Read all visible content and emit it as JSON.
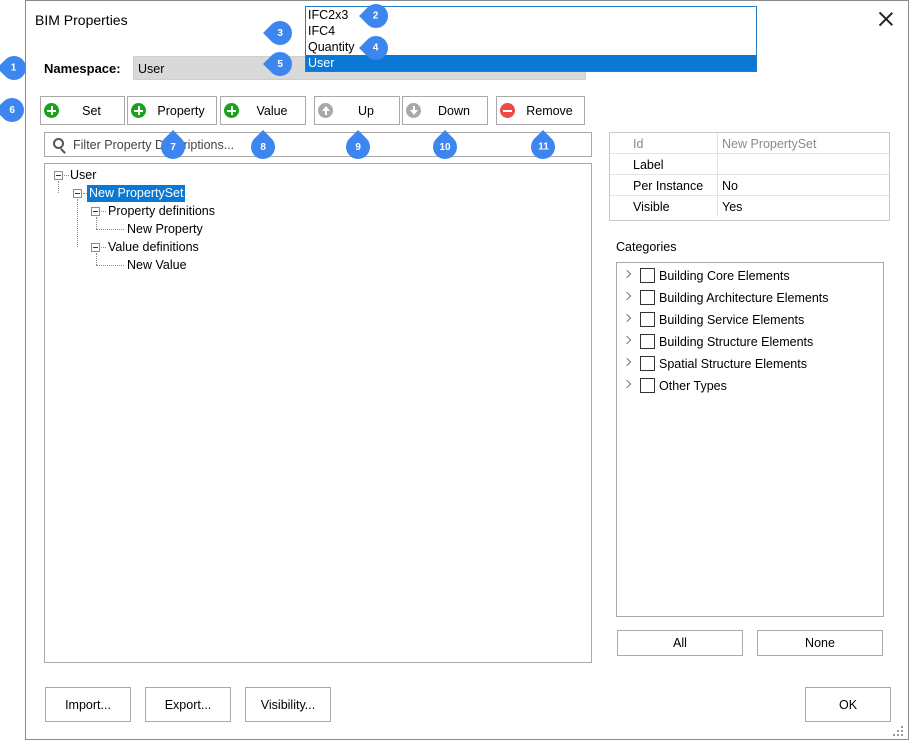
{
  "dialog": {
    "title": "BIM Properties"
  },
  "namespace": {
    "label": "Namespace:",
    "value": "User",
    "options": [
      "IFC2x3",
      "IFC4",
      "Quantity",
      "User"
    ],
    "selected_option": "User"
  },
  "toolbar": {
    "set": "Set",
    "property": "Property",
    "value": "Value",
    "up": "Up",
    "down": "Down",
    "remove": "Remove"
  },
  "filter": {
    "placeholder": "Filter Property Descriptions..."
  },
  "tree": {
    "root": "User",
    "set": "New PropertySet",
    "property_definitions": "Property definitions",
    "new_property": "New Property",
    "value_definitions": "Value definitions",
    "new_value": "New Value"
  },
  "properties": {
    "rows": [
      {
        "key": "Id",
        "value": "New PropertySet"
      },
      {
        "key": "Label",
        "value": ""
      },
      {
        "key": "Per Instance",
        "value": "No"
      },
      {
        "key": "Visible",
        "value": "Yes"
      }
    ]
  },
  "categories": {
    "label": "Categories",
    "items": [
      "Building Core Elements",
      "Building Architecture Elements",
      "Building Service Elements",
      "Building Structure Elements",
      "Spatial Structure Elements",
      "Other Types"
    ],
    "all": "All",
    "none": "None"
  },
  "footer": {
    "import": "Import...",
    "export": "Export...",
    "visibility": "Visibility...",
    "ok": "OK"
  },
  "callouts": [
    "1",
    "2",
    "3",
    "4",
    "5",
    "6",
    "7",
    "8",
    "9",
    "10",
    "11"
  ],
  "colors": {
    "accent": "#0a78d4",
    "callout": "#3d86f0",
    "add": "#1aa31a",
    "remove": "#ee4a4a"
  }
}
